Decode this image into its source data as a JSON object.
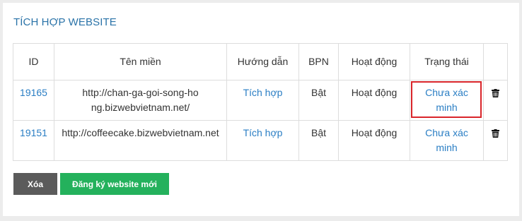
{
  "section": {
    "title": "TÍCH HỢP WEBSITE"
  },
  "table": {
    "headers": {
      "id": "ID",
      "domain": "Tên miền",
      "guide": "Hướng dẫn",
      "bpn": "BPN",
      "activity": "Hoạt động",
      "status": "Trạng thái"
    },
    "rows": [
      {
        "id": "19165",
        "domain": "http://chan-ga-goi-song-hong.bizwebvietnam.net/",
        "guide": "Tích hợp",
        "bpn": "Bật",
        "activity": "Hoạt động",
        "status": "Chưa xác minh",
        "highlighted": true
      },
      {
        "id": "19151",
        "domain": "http://coffeecake.bizwebvietnam.net",
        "guide": "Tích hợp",
        "bpn": "Bật",
        "activity": "Hoạt động",
        "status": "Chưa xác minh",
        "highlighted": false
      }
    ]
  },
  "buttons": {
    "delete": "Xóa",
    "register": "Đăng ký website mới"
  },
  "colors": {
    "link": "#2a7ec4",
    "title": "#2a73a8",
    "highlight_border": "#d9252a",
    "delete_button": "#5b5b5b",
    "register_button": "#24b15c"
  },
  "icons": {
    "row_action": "trash-icon"
  }
}
